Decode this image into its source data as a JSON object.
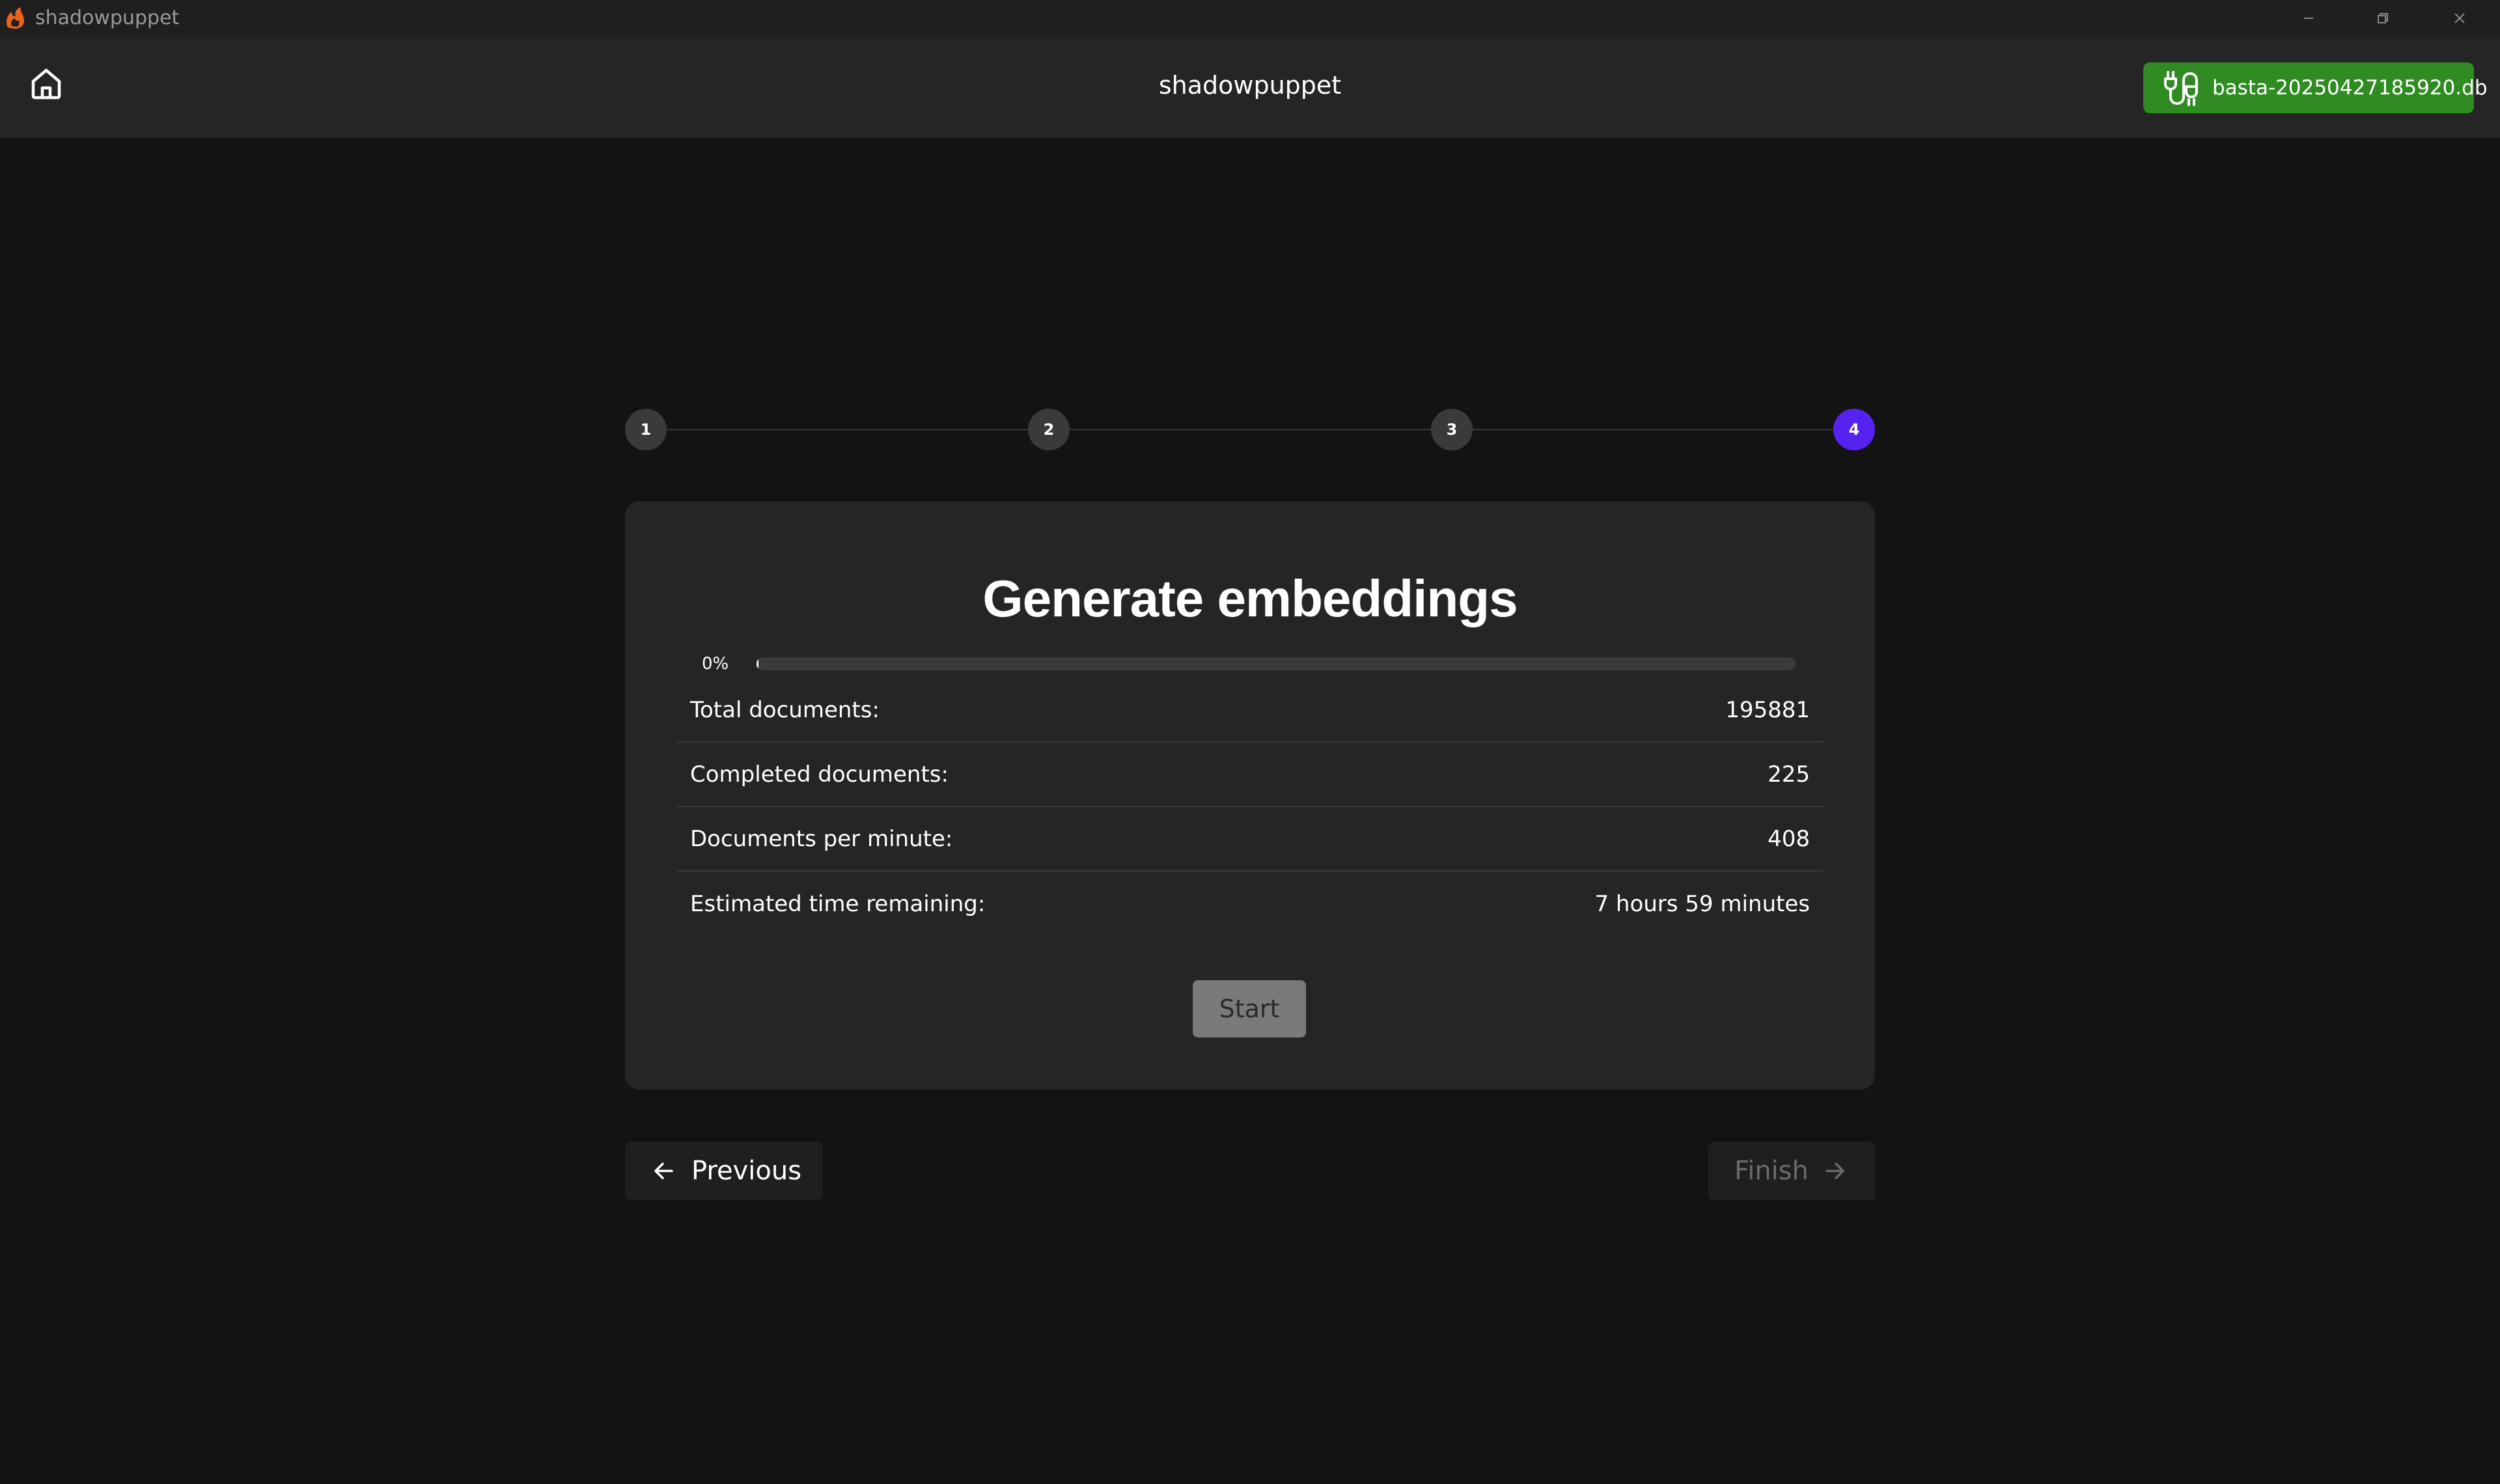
{
  "window": {
    "title": "shadowpuppet",
    "app_icon": "flame-logo-icon",
    "controls": [
      "minimize-icon",
      "restore-icon",
      "close-icon"
    ]
  },
  "header": {
    "home_icon": "home-icon",
    "title": "shadowpuppet",
    "database": {
      "icon": "plug-icon",
      "name": "basta-20250427185920.db",
      "color": "#2f8b22"
    }
  },
  "stepper": {
    "steps": [
      "1",
      "2",
      "3",
      "4"
    ],
    "active_step": "4",
    "active_color": "#5522f0"
  },
  "card": {
    "title": "Generate embeddings",
    "progress": {
      "label": "0%",
      "percent": 0
    },
    "stats": [
      {
        "label": "Total documents:",
        "value": "195881"
      },
      {
        "label": "Completed documents:",
        "value": "225"
      },
      {
        "label": "Documents per minute:",
        "value": "408"
      },
      {
        "label": "Estimated time remaining:",
        "value": "7 hours 59 minutes"
      }
    ],
    "start_label": "Start"
  },
  "navigation": {
    "previous_label": "Previous",
    "previous_icon": "arrow-left-icon",
    "finish_label": "Finish",
    "finish_icon": "arrow-right-icon",
    "finish_enabled": false
  }
}
